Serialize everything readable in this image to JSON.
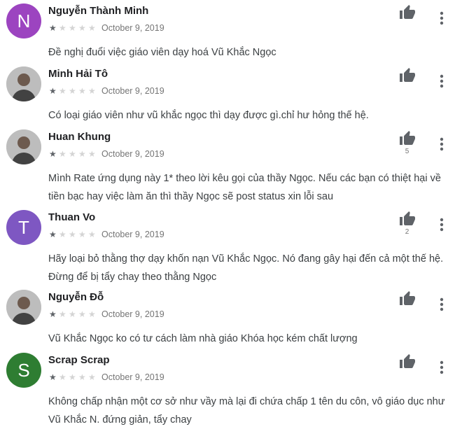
{
  "reviews": [
    {
      "name": "Nguyễn Thành Minh",
      "avatar": {
        "type": "letter",
        "letter": "N",
        "color": "#9c44c0"
      },
      "rating": 1,
      "date": "October 9, 2019",
      "likes": "",
      "text": "Đề nghị đuổi việc giáo viên dạy hoá Vũ Khắc Ngọc"
    },
    {
      "name": "Minh Hải Tô",
      "avatar": {
        "type": "photo",
        "icon": "person-photo-icon"
      },
      "rating": 1,
      "date": "October 9, 2019",
      "likes": "",
      "text": "Có loại giáo viên như vũ khắc ngọc thì dạy được gì.chỉ hư hỏng thế hệ."
    },
    {
      "name": "Huan Khung",
      "avatar": {
        "type": "photo",
        "icon": "person-photo-icon"
      },
      "rating": 1,
      "date": "October 9, 2019",
      "likes": "5",
      "text": "Mình Rate ứng dụng này 1* theo lời kêu gọi của thầy Ngọc. Nếu các bạn có thiệt hại về tiền bạc hay việc làm ăn thì thầy Ngọc sẽ post status xin lỗi sau"
    },
    {
      "name": "Thuan Vo",
      "avatar": {
        "type": "letter",
        "letter": "T",
        "color": "#7e57c2"
      },
      "rating": 1,
      "date": "October 9, 2019",
      "likes": "2",
      "text": "Hãy loại bỏ thằng thợ dạy khốn nạn Vũ Khắc Ngọc. Nó đang gây hại đến cả một thế hệ. Đừng để bị tẩy chay theo thằng Ngọc"
    },
    {
      "name": "Nguyễn Đỗ",
      "avatar": {
        "type": "photo",
        "icon": "person-photo-icon"
      },
      "rating": 1,
      "date": "October 9, 2019",
      "likes": "",
      "text": "Vũ Khắc Ngọc ko có tư cách làm nhà giáo Khóa học kém chất lượng"
    },
    {
      "name": "Scrap Scrap",
      "avatar": {
        "type": "letter",
        "letter": "S",
        "color": "#2e7d32"
      },
      "rating": 1,
      "date": "October 9, 2019",
      "likes": "",
      "text": "Không chấp nhận một cơ sở như vầy mà lại đi chứa chấp 1 tên du côn, vô giáo dục như Vũ Khắc N. đứng giản, tẩy chay"
    }
  ],
  "icons": {
    "like": "thumb-up-icon",
    "more": "more-vert-icon",
    "star": "star-icon"
  },
  "colors": {
    "icon": "#5f6368",
    "star_on": "#5f6368",
    "star_off": "#d4d4d4",
    "meta": "#757575"
  }
}
